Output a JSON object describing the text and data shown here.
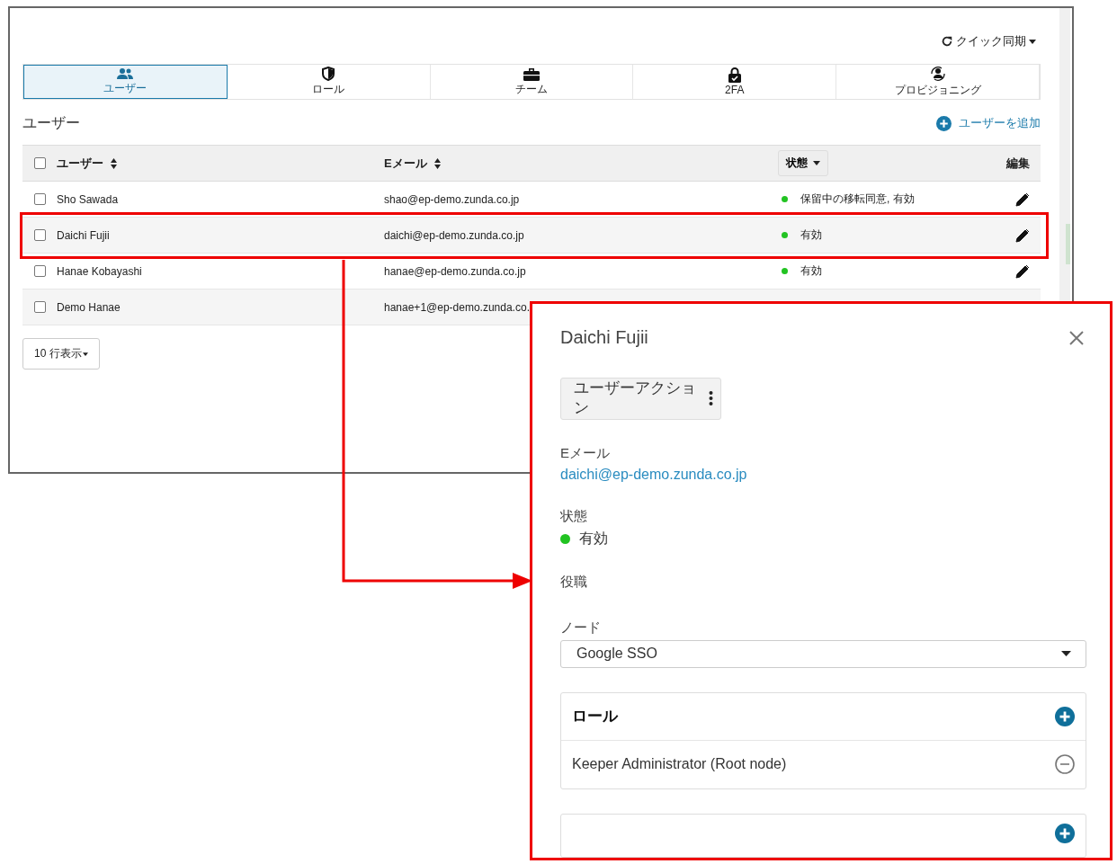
{
  "toolbar": {
    "sync_label": "クイック同期"
  },
  "tabs": [
    {
      "label": "ユーザー",
      "selected": true
    },
    {
      "label": "ロール",
      "selected": false
    },
    {
      "label": "チーム",
      "selected": false
    },
    {
      "label": "2FA",
      "selected": false
    },
    {
      "label": "プロビジョニング",
      "selected": false
    }
  ],
  "section_title": "ユーザー",
  "add_user": "ユーザーを追加",
  "table": {
    "header_checked": false,
    "columns": [
      {
        "label": "ユーザー",
        "kind": "sort"
      },
      {
        "label": "Eメール",
        "kind": "sort"
      },
      {
        "label": "状態",
        "kind": "filter"
      },
      {
        "label": "編集",
        "kind": "plain"
      }
    ],
    "rows": [
      {
        "name": "Sho Sawada",
        "email": "shao@ep-demo.zunda.co.jp",
        "status": "保留中の移転同意, 有効",
        "color": "#22c322",
        "checked": false,
        "highlighted": false
      },
      {
        "name": "Daichi Fujii",
        "email": "daichi@ep-demo.zunda.co.jp",
        "status": "有効",
        "color": "#22c322",
        "checked": false,
        "highlighted": true
      },
      {
        "name": "Hanae Kobayashi",
        "email": "hanae@ep-demo.zunda.co.jp",
        "status": "有効",
        "color": "#22c322",
        "checked": false,
        "highlighted": false
      },
      {
        "name": "Demo Hanae",
        "email": "hanae+1@ep-demo.zunda.co.",
        "checked": false,
        "highlighted": false
      }
    ]
  },
  "page_size": "10 行表示",
  "detail": {
    "title": "Daichi Fujii",
    "action_button": "ユーザーアクション",
    "fields": [
      {
        "label": "Eメール",
        "kind": "link",
        "value": "daichi@ep-demo.zunda.co.jp"
      },
      {
        "label": "状態",
        "kind": "status",
        "value": "有効",
        "color": "#22c322"
      },
      {
        "label": "役職",
        "kind": "empty"
      }
    ],
    "node": {
      "label": "ノード",
      "value": "Google SSO"
    },
    "roles": {
      "title": "ロール",
      "items": [
        "Keeper Administrator (Root node)"
      ]
    }
  }
}
